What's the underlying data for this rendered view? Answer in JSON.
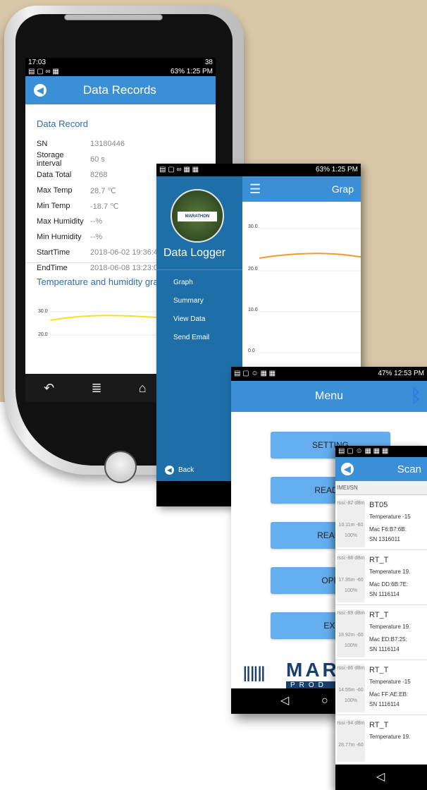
{
  "phone1": {
    "status_top": {
      "time": "17:03",
      "right": "38"
    },
    "status_bottom": {
      "right": "63% 1:25 PM"
    },
    "title": "Data Records",
    "section_title": "Data Record",
    "records": [
      {
        "key": "SN",
        "value": "13180446"
      },
      {
        "key": "Storage interval",
        "value": "60 s"
      },
      {
        "key": "Data Total",
        "value": "8268"
      },
      {
        "key": "Max Temp",
        "value": "28.7 ℃"
      },
      {
        "key": "Min Temp",
        "value": "-18.7 ℃"
      },
      {
        "key": "Max Humidity",
        "value": "--%"
      },
      {
        "key": "Min Humidity",
        "value": "--%"
      },
      {
        "key": "StartTime",
        "value": "2018-06-02 19:36:43"
      },
      {
        "key": "EndTime",
        "value": "2018-06-08 13:23:03"
      }
    ],
    "graph_title": "Temperature and humidity gra",
    "graph_ticks": [
      "30.0",
      "20.0"
    ]
  },
  "screen2": {
    "status": "63% 1:25 PM",
    "logo_text": "MARATHON",
    "drawer_title": "Data Logger",
    "menu": [
      "Graph",
      "Summary",
      "View Data",
      "Send Email"
    ],
    "back": "Back",
    "graph_title": "Grap",
    "ticks": [
      "30.0",
      "20.0",
      "10.0",
      "0.0"
    ]
  },
  "screen3": {
    "status": "47% 12:53 PM",
    "title": "Menu",
    "buttons": [
      "SETTING",
      "READ D",
      "REALT",
      "OPE",
      "EXI"
    ],
    "logo_top": "MAR",
    "logo_bottom": "PROD"
  },
  "screen4": {
    "title": "Scan",
    "header": "IMEI/SN",
    "items": [
      {
        "rssi": "rssi:-82 dBm",
        "dist": "10.11m -60",
        "batt": "100%",
        "name": "BT05",
        "temp": "Temperature -15",
        "mac": "Mac F6:B7:6B:",
        "sn": "SN 1316011"
      },
      {
        "rssi": "rssi:-88 dBm",
        "dist": "17.35m -60",
        "batt": "100%",
        "name": "RT_T",
        "temp": "Temperature 19.",
        "mac": "Mac DD:6B:7E:",
        "sn": "SN 1116114"
      },
      {
        "rssi": "rssi:-89 dBm",
        "dist": "18.92m -60",
        "batt": "100%",
        "name": "RT_T",
        "temp": "Temperature 19.",
        "mac": "Mac ED:B7:25:",
        "sn": "SN 1116114"
      },
      {
        "rssi": "rssi:-86 dBm",
        "dist": "14.55m -60",
        "batt": "100%",
        "name": "RT_T",
        "temp": "Temperature -15",
        "mac": "Mac FF:AE:EB:",
        "sn": "SN 1116114"
      },
      {
        "rssi": "rssi:-94 dBm",
        "dist": "28.77m -60",
        "batt": "",
        "name": "RT_T",
        "temp": "Temperature 19.",
        "mac": "",
        "sn": ""
      }
    ]
  },
  "colors": {
    "accent": "#3b8fd6",
    "drawer": "#1e6fa8",
    "button": "#64aef0",
    "orange_line": "#f39a2b",
    "yellow_line": "#f5e12a"
  }
}
